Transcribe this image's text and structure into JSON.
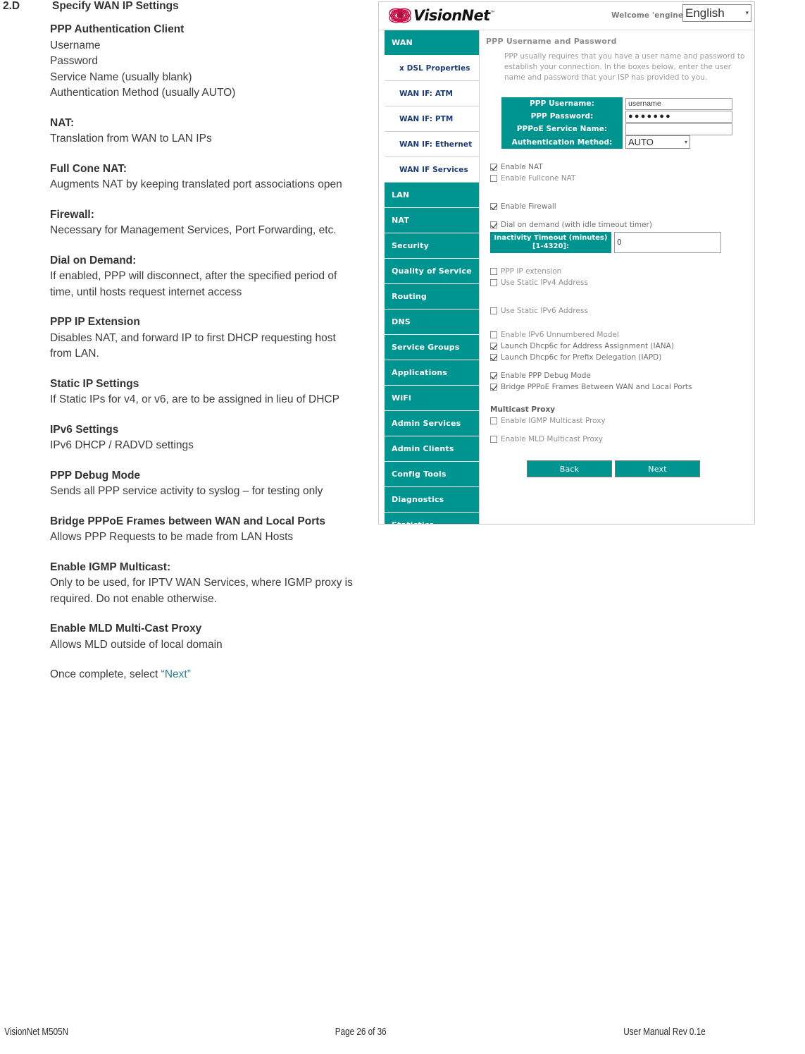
{
  "document": {
    "section_number": "2.D",
    "section_title": "Specify WAN IP Settings",
    "blocks": [
      {
        "heading": "PPP Authentication Client",
        "lines": [
          "Username",
          "Password",
          "Service Name (usually blank)",
          "Authentication Method  (usually AUTO)"
        ]
      },
      {
        "heading": "NAT:",
        "lines": [
          "Translation from WAN to LAN IPs"
        ]
      },
      {
        "heading": "Full Cone NAT:",
        "lines": [
          "Augments NAT by keeping translated port associations open"
        ]
      },
      {
        "heading": "Firewall:",
        "lines": [
          "Necessary for Management Services, Port Forwarding, etc."
        ]
      },
      {
        "heading": "Dial on Demand:",
        "lines": [
          "If enabled, PPP will disconnect, after the specified period of time, until hosts request internet access"
        ]
      },
      {
        "heading": "PPP IP Extension",
        "lines": [
          "Disables NAT, and forward IP to first DHCP requesting host from LAN."
        ]
      },
      {
        "heading": "Static IP Settings",
        "lines": [
          "If Static IPs for v4, or v6, are to be assigned in lieu of DHCP"
        ]
      },
      {
        "heading": "IPv6 Settings",
        "lines": [
          "IPv6 DHCP / RADVD settings"
        ]
      },
      {
        "heading": "PPP Debug Mode",
        "lines": [
          "Sends all PPP service activity to syslog – for testing only"
        ]
      },
      {
        "heading": "Bridge PPPoE Frames between WAN and Local Ports",
        "lines": [
          "Allows PPP Requests to be made from LAN Hosts"
        ]
      },
      {
        "heading": "Enable IGMP Multicast:",
        "lines": [
          "Only to be used, for IPTV WAN Services, where IGMP proxy is required. Do not enable otherwise."
        ]
      },
      {
        "heading": "Enable MLD Multi-Cast Proxy",
        "lines": [
          "Allows MLD outside of local domain"
        ]
      }
    ],
    "final_note_prefix": "Once complete, select ",
    "final_note_link": "“Next”"
  },
  "screenshot": {
    "header": {
      "brand": "VisionNet",
      "trademark": "™",
      "welcome": "Welcome 'engineering'",
      "language": "English",
      "language_caret": "⌄"
    },
    "sidebar": {
      "items": [
        {
          "label": "WAN",
          "type": "main"
        },
        {
          "label": "x DSL Properties",
          "type": "sub"
        },
        {
          "label": "WAN IF: ATM",
          "type": "sub"
        },
        {
          "label": "WAN IF: PTM",
          "type": "sub"
        },
        {
          "label": "WAN IF: Ethernet",
          "type": "sub"
        },
        {
          "label": "WAN IF Services",
          "type": "sub"
        },
        {
          "label": "LAN",
          "type": "main"
        },
        {
          "label": "NAT",
          "type": "main"
        },
        {
          "label": "Security",
          "type": "main"
        },
        {
          "label": "Quality of Service",
          "type": "main"
        },
        {
          "label": "Routing",
          "type": "main"
        },
        {
          "label": "DNS",
          "type": "main"
        },
        {
          "label": "Service Groups",
          "type": "main"
        },
        {
          "label": "Applications",
          "type": "main"
        },
        {
          "label": "WiFi",
          "type": "main"
        },
        {
          "label": "Admin Services",
          "type": "main"
        },
        {
          "label": "Admin Clients",
          "type": "main"
        },
        {
          "label": "Config Tools",
          "type": "main"
        },
        {
          "label": "Diagnostics",
          "type": "main"
        },
        {
          "label": "Statistics",
          "type": "main"
        }
      ]
    },
    "content": {
      "page_title": "PPP Username and Password",
      "description": "PPP usually requires that you have a user name and password to establish your connection. In the boxes below, enter the user name and password that your ISP has provided to you.",
      "fields": [
        {
          "label": "PPP Username:",
          "value": "username",
          "control": "text"
        },
        {
          "label": "PPP Password:",
          "value": "●●●●●●●",
          "control": "password"
        },
        {
          "label": "PPPoE Service Name:",
          "value": "",
          "control": "text"
        },
        {
          "label": "Authentication Method:",
          "value": "AUTO",
          "control": "select"
        }
      ],
      "checkbox_groups": [
        {
          "items": [
            {
              "label": "Enable NAT",
              "checked": true
            },
            {
              "label": "Enable Fullcone NAT",
              "checked": false
            }
          ]
        },
        {
          "items": [
            {
              "label": "Enable Firewall",
              "checked": true
            }
          ]
        },
        {
          "items": [
            {
              "label": "Dial on demand (with idle timeout timer)",
              "checked": true
            }
          ]
        },
        {
          "items": [
            {
              "label": "PPP IP extension",
              "checked": false
            },
            {
              "label": "Use Static IPv4 Address",
              "checked": false
            }
          ]
        },
        {
          "items": [
            {
              "label": "Use Static IPv6 Address",
              "checked": false
            }
          ]
        },
        {
          "items": [
            {
              "label": "Enable IPv6 Unnumbered Model",
              "checked": false
            },
            {
              "label": "Launch Dhcp6c for Address Assignment (IANA)",
              "checked": true
            },
            {
              "label": "Launch Dhcp6c for Prefix Delegation (IAPD)",
              "checked": true
            }
          ]
        },
        {
          "items": [
            {
              "label": "Enable PPP Debug Mode",
              "checked": true
            },
            {
              "label": "Bridge PPPoE Frames Between WAN and Local Ports",
              "checked": true
            }
          ]
        }
      ],
      "inactivity_timeout": {
        "label_line1": "Inactivity Timeout (minutes)",
        "label_line2": "[1-4320]:",
        "value": "0"
      },
      "multicast": {
        "title": "Multicast Proxy",
        "items": [
          {
            "label": "Enable IGMP Multicast Proxy",
            "checked": false
          },
          {
            "label": "Enable MLD Multicast Proxy",
            "checked": false
          }
        ]
      },
      "buttons": {
        "back": "Back",
        "next": "Next"
      }
    },
    "colors": {
      "teal": "#009491",
      "nav_link": "#1b3a7a",
      "logo_red": "#c8104a"
    }
  },
  "footer": {
    "left": "VisionNet   M505N",
    "center": "Page 26 of 36",
    "right": "User Manual Rev 0.1e"
  }
}
